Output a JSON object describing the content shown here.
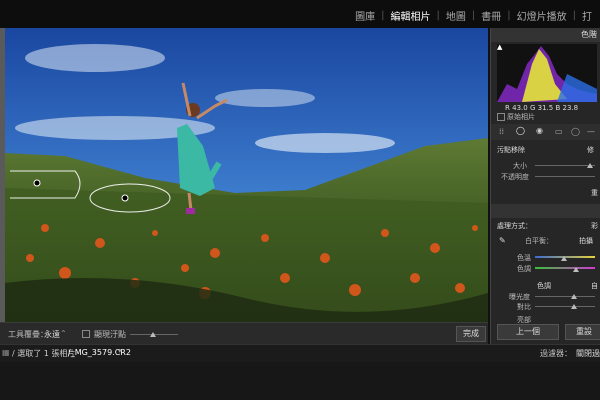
{
  "modules": {
    "items": [
      "圖庫",
      "編輯相片",
      "地圖",
      "書冊",
      "幻燈片播放",
      "打"
    ],
    "active_index": 1
  },
  "toolbar": {
    "tool_overlay_label": "工具覆疊：",
    "tool_overlay_value": "永遠",
    "show_pins_label": "顯現汙點",
    "done_label": "完成"
  },
  "filmstrip": {
    "path_label": "/ 選取了 1 張相片",
    "file_name": "/_MG_3579.CR2",
    "filter_label": "過濾器：",
    "filter_value": "關閉過"
  },
  "right_panel": {
    "histogram_title": "色階",
    "rgb_readout": {
      "r_label": "R",
      "r": "43.0",
      "g_label": "G",
      "g": "31.5",
      "b_label": "B",
      "b": "23.8"
    },
    "original_photo_label": "原始相片",
    "spot_removal_label": "污點移除",
    "spot_mode_value": "修",
    "size_label": "大小",
    "opacity_label": "不透明度",
    "reset_label": "重",
    "treatment_label": "處理方式：",
    "treatment_value": "彩",
    "white_balance_label": "白平衡：",
    "white_balance_value": "拍攝",
    "temp_label": "色溫",
    "tint_label": "色調",
    "tone_label": "色調",
    "tone_value": "自",
    "exposure_label": "曝光度",
    "contrast_label": "對比",
    "highlights_label": "亮部",
    "prev_button": "上一個",
    "reset_button": "重設"
  },
  "colors": {
    "accent": "#3a3a3a",
    "sky_top": "#1c4fa0",
    "meadow": "#4d6b2e",
    "flowers": "#c8541c"
  }
}
